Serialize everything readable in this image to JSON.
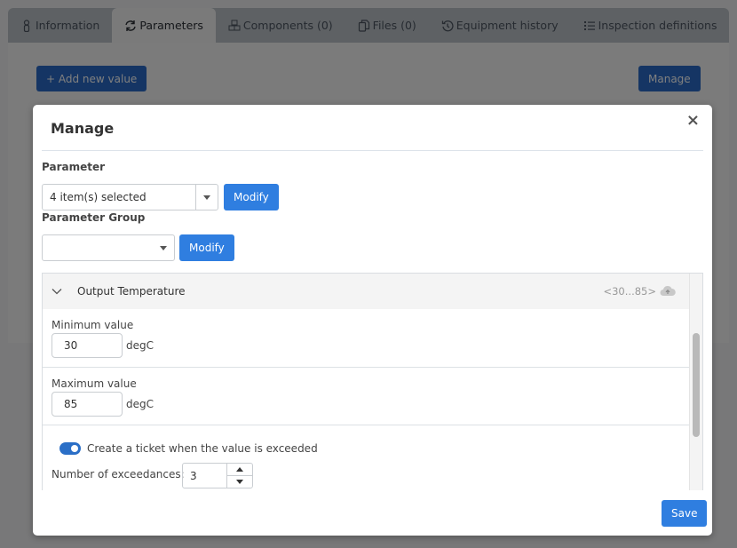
{
  "tabs": [
    {
      "label": "Information",
      "icon": "person-icon",
      "active": false
    },
    {
      "label": "Parameters",
      "icon": "refresh-icon",
      "active": true
    },
    {
      "label": "Components (0)",
      "icon": "cubes-icon",
      "active": false
    },
    {
      "label": "Files (0)",
      "icon": "files-icon",
      "active": false
    },
    {
      "label": "Equipment history",
      "icon": "history-icon",
      "active": false
    },
    {
      "label": "Inspection definitions",
      "icon": "list-icon",
      "active": false
    }
  ],
  "page": {
    "add_button": "+ Add new value",
    "manage_button": "Manage"
  },
  "modal": {
    "title": "Manage",
    "close": "×",
    "parameter": {
      "label": "Parameter",
      "selected": "4 item(s) selected",
      "modify": "Modify"
    },
    "parameter_group": {
      "label": "Parameter Group",
      "selected": "",
      "modify": "Modify"
    },
    "accordion": {
      "title": "Output Temperature",
      "range": "<30...85>",
      "expanded": true,
      "min": {
        "label": "Minimum value",
        "value": "30",
        "unit": "degC"
      },
      "max": {
        "label": "Maximum value",
        "value": "85",
        "unit": "degC"
      },
      "ticket_toggle": {
        "label": "Create a ticket when the value is exceeded",
        "on": true
      },
      "exceedances": {
        "label": "Number of exceedances:",
        "value": "3"
      }
    },
    "save": "Save"
  },
  "colors": {
    "primary": "#2f7ee0",
    "toggle_on": "#2b6fc7"
  }
}
